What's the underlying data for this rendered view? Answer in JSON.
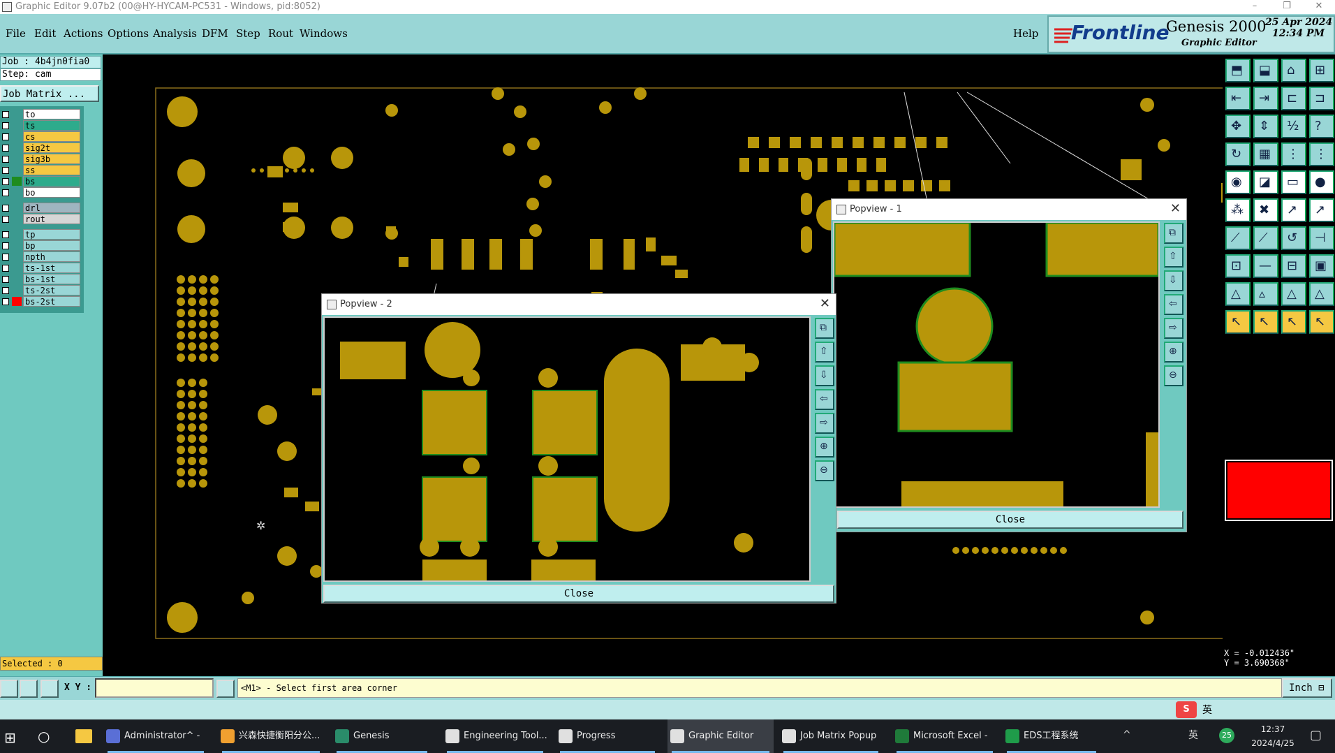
{
  "window": {
    "title": "Graphic Editor 9.07b2 (00@HY-HYCAM-PC531 - Windows, pid:8052)",
    "controls": [
      "–",
      "❐",
      "✕"
    ]
  },
  "menu": {
    "items": [
      {
        "label": "File"
      },
      {
        "label": "Edit"
      },
      {
        "label": "Actions"
      },
      {
        "label": "Options"
      },
      {
        "label": "Analysis"
      },
      {
        "label": "DFM"
      },
      {
        "label": "Step"
      },
      {
        "label": "Rout"
      },
      {
        "label": "Windows"
      }
    ],
    "help": "Help"
  },
  "brand": {
    "logo": "Frontline",
    "product": "Genesis 2000",
    "subtitle": "Graphic Editor",
    "date": "25 Apr 2024",
    "time": "12:34 PM"
  },
  "job": {
    "job_label": "Job : 4b4jn0fia0",
    "step_label": "Step: cam",
    "matrix_button": "Job Matrix ..."
  },
  "layers": [
    {
      "name": "to",
      "color": "#ffffff",
      "active": false
    },
    {
      "name": "ts",
      "color": "#2eab8c",
      "active": false
    },
    {
      "name": "cs",
      "color": "#f5c842",
      "active": false
    },
    {
      "name": "sig2t",
      "color": "#f5c842",
      "active": false
    },
    {
      "name": "sig3b",
      "color": "#f5c842",
      "active": false
    },
    {
      "name": "ss",
      "color": "#f5c842",
      "active": false
    },
    {
      "name": "bs",
      "color": "#2eab8c",
      "active": true
    },
    {
      "name": "bo",
      "color": "#ffffff",
      "active": false
    },
    {
      "name": "drl",
      "color": "#9fb5c0",
      "active": false
    },
    {
      "name": "rout",
      "color": "#d6d6d6",
      "active": false
    },
    {
      "name": "tp",
      "color": "#99d6d6",
      "active": false
    },
    {
      "name": "bp",
      "color": "#99d6d6",
      "active": false
    },
    {
      "name": "npth",
      "color": "#99d6d6",
      "active": false
    },
    {
      "name": "ts-1st",
      "color": "#99d6d6",
      "active": false
    },
    {
      "name": "bs-1st",
      "color": "#99d6d6",
      "active": false
    },
    {
      "name": "ts-2st",
      "color": "#99d6d6",
      "active": false
    },
    {
      "name": "bs-2st",
      "color": "#99d6d6",
      "active": false
    }
  ],
  "popview1": {
    "title": "Popview - 1",
    "close": "Close"
  },
  "popview2": {
    "title": "Popview - 2",
    "close": "Close"
  },
  "status": {
    "selected": "Selected : 0",
    "x_readout": "X = -0.012436\"",
    "y_readout": "Y = 3.690368\"",
    "xy_label": "X Y :",
    "xy_value": "",
    "prompt": "<M1> - Select first area corner",
    "units": "Inch"
  },
  "colors": {
    "pad": "#b8960a",
    "pad_outline": "#1f8c1f",
    "current_color": "#ff0000",
    "menu_bg": "#99d6d6"
  },
  "taskbar": {
    "items": [
      {
        "label": "Administrator^ - ...",
        "icon": "user-icon"
      },
      {
        "label": "兴森快捷衡阳分公...",
        "icon": "globe-icon"
      },
      {
        "label": "Genesis",
        "icon": "genesis-icon"
      },
      {
        "label": "Engineering Tool...",
        "icon": "tool-icon"
      },
      {
        "label": "Progress",
        "icon": "progress-icon"
      },
      {
        "label": "Graphic Editor 9....",
        "icon": "editor-icon"
      },
      {
        "label": "Job Matrix Popup",
        "icon": "matrix-icon"
      },
      {
        "label": "Microsoft Excel - ...",
        "icon": "excel-icon"
      },
      {
        "label": "EDS工程系统",
        "icon": "eds-icon"
      }
    ],
    "ime": "英",
    "time": "12:37",
    "date": "2024/4/25",
    "badge": "25"
  }
}
